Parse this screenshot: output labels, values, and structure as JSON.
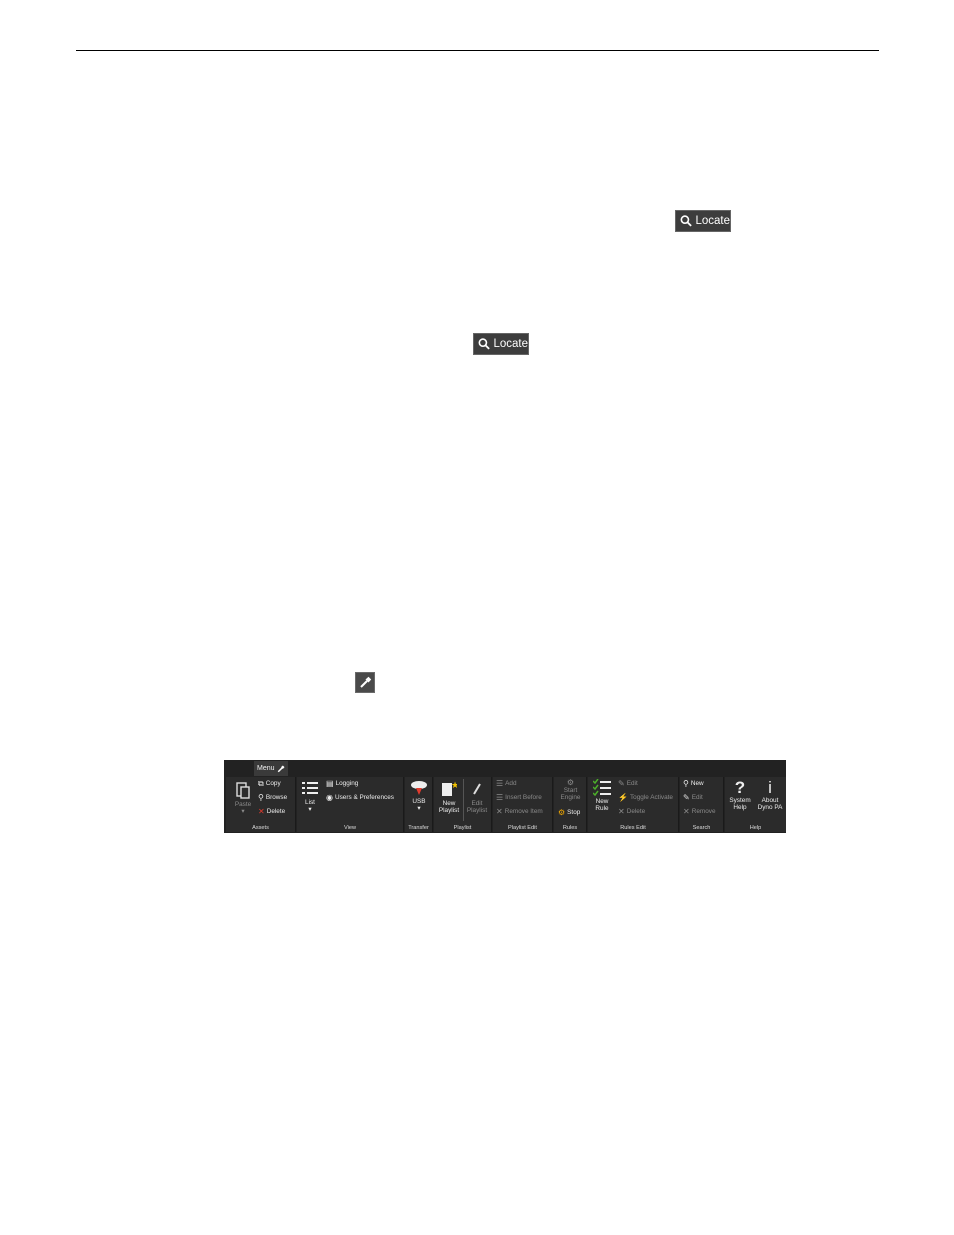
{
  "locate_buttons": [
    {
      "label": "Locate"
    },
    {
      "label": "Locate"
    }
  ],
  "ribbon": {
    "menu_tab": "Menu",
    "groups": {
      "assets": {
        "label": "Assets",
        "paste": "Paste",
        "copy": "Copy",
        "browse": "Browse",
        "delete": "Delete"
      },
      "view": {
        "label": "View",
        "list": "List",
        "logging": "Logging",
        "users_prefs": "Users & Preferences"
      },
      "transfer": {
        "label": "Transfer",
        "usb": "USB"
      },
      "playlist": {
        "label": "Playlist",
        "new_1": "New",
        "new_2": "Playlist",
        "edit_1": "Edit",
        "edit_2": "Playlist"
      },
      "playlist_edit": {
        "label": "Playlist Edit",
        "add": "Add",
        "insert_before": "Insert Before",
        "remove_item": "Remove Item"
      },
      "rules": {
        "label": "Rules",
        "start_1": "Start",
        "start_2": "Engine",
        "stop": "Stop"
      },
      "rules_edit": {
        "label": "Rules Edit",
        "new_1": "New",
        "new_2": "Rule",
        "edit": "Edit",
        "toggle_activate": "Toggle Activate",
        "delete": "Delete"
      },
      "search": {
        "label": "Search",
        "new": "New",
        "edit": "Edit",
        "remove": "Remove"
      },
      "help": {
        "label": "Help",
        "system_1": "System",
        "system_2": "Help",
        "about_1": "About",
        "about_2": "Dyno PA"
      }
    }
  },
  "colors": {
    "ribbon_bg": "#222222",
    "group_bg": "#2b2b2b",
    "delete_red": "#e23b2e",
    "rule_green": "#4caf2a"
  }
}
